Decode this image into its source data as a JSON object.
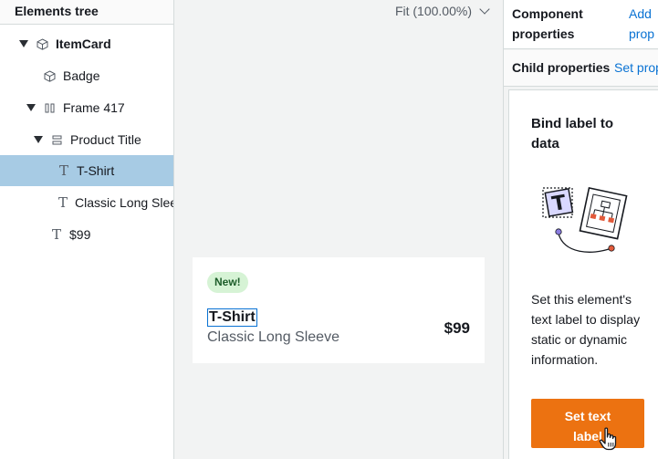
{
  "elements_tree": {
    "header": "Elements tree",
    "items": [
      {
        "label": "ItemCard",
        "icon": "component-cube-icon",
        "expanded": true,
        "bold": true
      },
      {
        "label": "Badge",
        "icon": "component-cube-icon"
      },
      {
        "label": "Frame 417",
        "icon": "frame-columns-icon",
        "expanded": true
      },
      {
        "label": "Product Title",
        "icon": "frame-rows-icon",
        "expanded": true
      },
      {
        "label": "T-Shirt",
        "icon": "text-icon",
        "selected": true
      },
      {
        "label": "Classic Long Sleeve",
        "icon": "text-icon"
      },
      {
        "label": "$99",
        "icon": "text-icon"
      }
    ]
  },
  "canvas": {
    "zoom_label": "Fit (100.00%)",
    "card": {
      "badge": "New!",
      "title": "T-Shirt",
      "subtitle": "Classic Long Sleeve",
      "price": "$99"
    }
  },
  "properties": {
    "component_label": "Component properties",
    "component_link": "Add prop",
    "child_label": "Child properties",
    "child_link": "Set prop",
    "help": {
      "title": "Bind label to data",
      "body": "Set this element's text label to display static or dynamic information.",
      "button": "Set text label"
    }
  },
  "colors": {
    "selected_row": "#a7cbe4",
    "link": "#0972d3",
    "cta": "#ec7211",
    "badge_bg": "#d6f3d5"
  }
}
